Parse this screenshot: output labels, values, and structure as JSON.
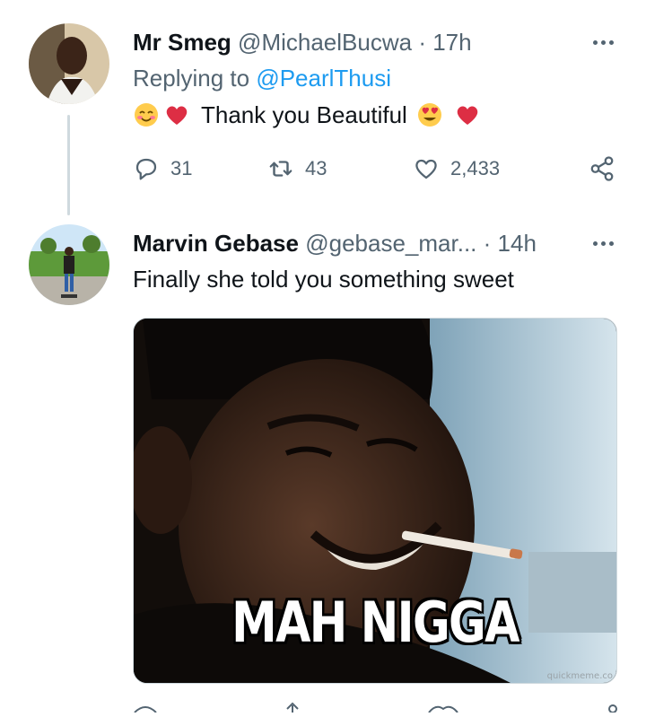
{
  "tweet1": {
    "name": "Mr Smeg",
    "handle": "@MichaelBucwa",
    "dot": "·",
    "time": "17h",
    "replying_prefix": "Replying to ",
    "replying_to": "@PearlThusi",
    "text": "Thank you Beautiful",
    "emojis": [
      "smiling-face-with-smiling-eyes",
      "red-heart",
      "smiling-face-with-heart-eyes",
      "red-heart"
    ],
    "actions": {
      "replies": "31",
      "retweets": "43",
      "likes": "2,433"
    }
  },
  "tweet2": {
    "name": "Marvin Gebase",
    "handle": "@gebase_mar...",
    "dot": "·",
    "time": "14h",
    "text": "Finally she told you something sweet",
    "media": {
      "caption": "MAH NIGGA",
      "watermark": "quickmeme.co"
    }
  },
  "colors": {
    "accent": "#1d9bf0",
    "secondary_text": "#536471",
    "primary_text": "#0f1419",
    "heart": "#e0245e"
  }
}
